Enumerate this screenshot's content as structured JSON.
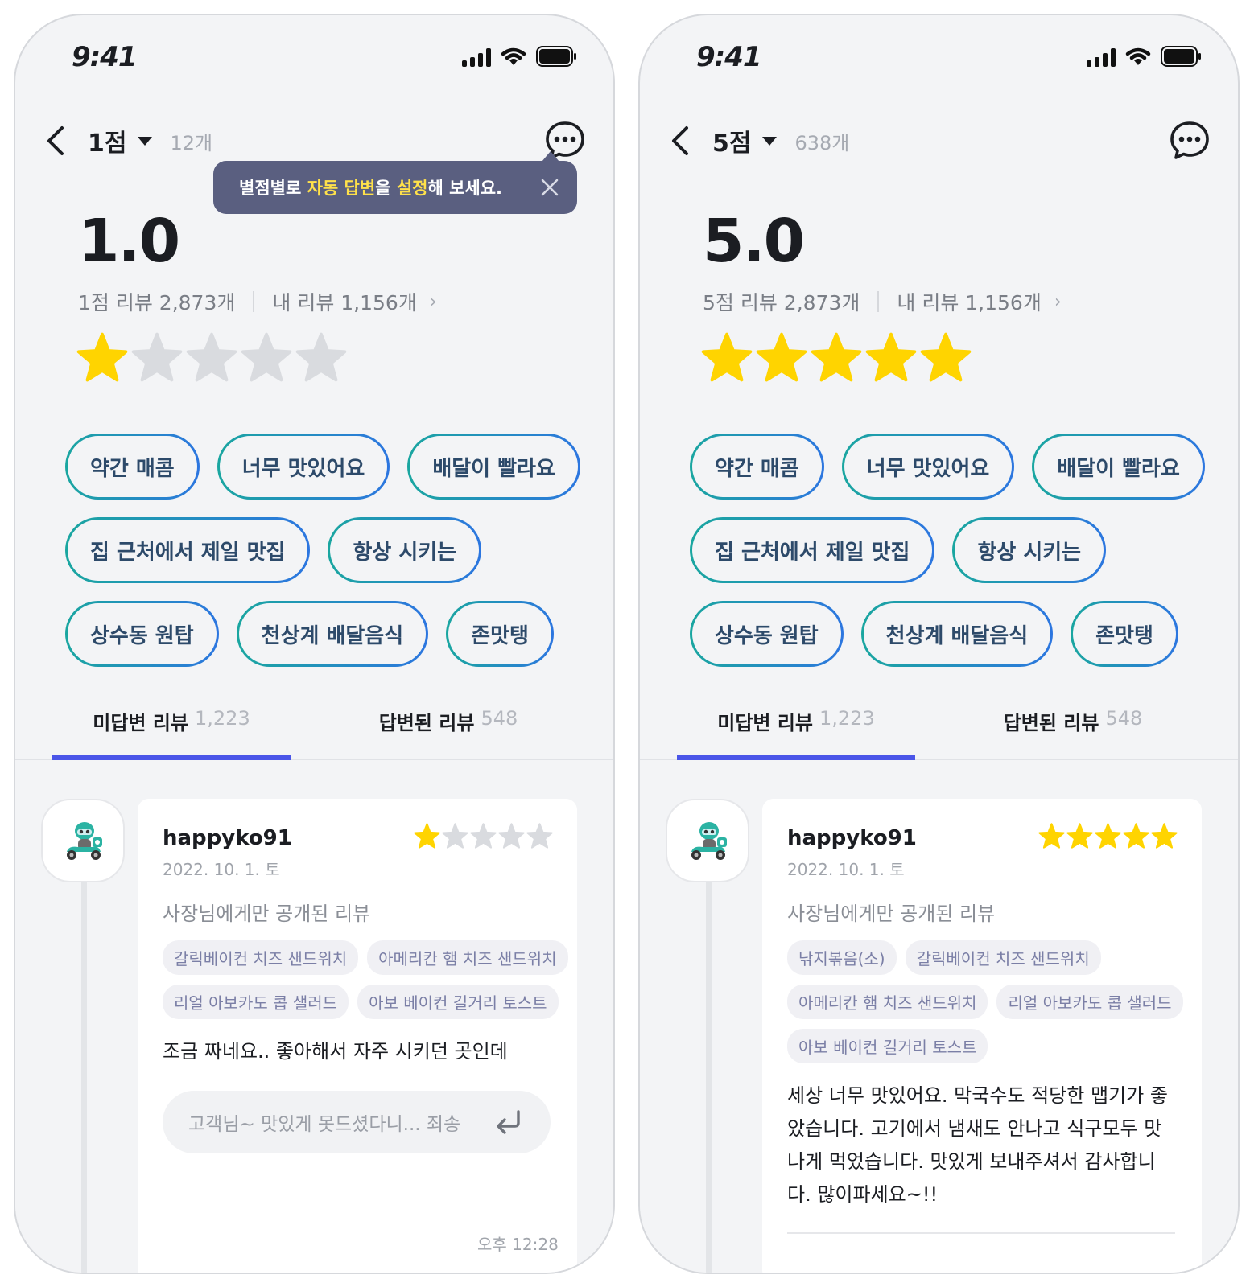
{
  "phones": [
    {
      "status": {
        "time": "9:41"
      },
      "header": {
        "score_label": "1점",
        "count_label": "12개"
      },
      "tooltip": {
        "pre": "별점별로 ",
        "hl1": "자동 답변",
        "mid": "을 ",
        "hl2": "설정",
        "post": "해 보세요."
      },
      "rating": {
        "value": "1.0",
        "label": "1점 리뷰 2,873개",
        "my_label": "내 리뷰 1,156개",
        "stars_filled": 1,
        "stars_total": 5
      },
      "keywords": [
        [
          "약간 매콤",
          "너무 맛있어요",
          "배달이 빨라요"
        ],
        [
          "집 근처에서 제일 맛집",
          "항상 시키는"
        ],
        [
          "상수동 원탑",
          "천상계 배달음식",
          "존맛탱"
        ]
      ],
      "tabs": [
        {
          "label": "미답변 리뷰",
          "count": "1,223"
        },
        {
          "label": "답변된 리뷰",
          "count": "548"
        }
      ],
      "review": {
        "username": "happyko91",
        "date": "2022. 10. 1. 토",
        "stars_filled": 1,
        "private_label": "사장님에게만 공개된 리뷰",
        "menu_tags": [
          "갈릭베이컨 치즈 샌드위치",
          "아메리칸 햄 치즈 샌드위치",
          "리얼 아보카도 콥 샐러드",
          "아보 베이컨 길거리 토스트"
        ],
        "text": "조금 짜네요.. 좋아해서 자주 시키던 곳인데",
        "reply_placeholder": "고객님~ 맛있게 못드셨다니... 죄송",
        "time": "오후 12:28"
      }
    },
    {
      "status": {
        "time": "9:41"
      },
      "header": {
        "score_label": "5점",
        "count_label": "638개"
      },
      "rating": {
        "value": "5.0",
        "label": "5점 리뷰 2,873개",
        "my_label": "내 리뷰 1,156개",
        "stars_filled": 5,
        "stars_total": 5
      },
      "keywords": [
        [
          "약간 매콤",
          "너무 맛있어요",
          "배달이 빨라요"
        ],
        [
          "집 근처에서 제일 맛집",
          "항상 시키는"
        ],
        [
          "상수동 원탑",
          "천상계 배달음식",
          "존맛탱"
        ]
      ],
      "tabs": [
        {
          "label": "미답변 리뷰",
          "count": "1,223"
        },
        {
          "label": "답변된 리뷰",
          "count": "548"
        }
      ],
      "review": {
        "username": "happyko91",
        "date": "2022. 10. 1. 토",
        "stars_filled": 5,
        "private_label": "사장님에게만 공개된 리뷰",
        "menu_tags": [
          "낚지볶음(소)",
          "갈릭베이컨 치즈 샌드위치",
          "아메리칸 햄 치즈 샌드위치",
          "리얼 아보카도 콥 샐러드",
          "아보 베이컨 길거리 토스트"
        ],
        "text": "세상 너무 맛있어요. 막국수도 적당한 맵기가 좋았습니다. 고기에서 냄새도 안나고 식구모두 맛나게 먹었습니다. 맛있게 보내주셔서 감사합니다. 많이파세요~!!"
      }
    }
  ],
  "colors": {
    "star_on": "#ffd400",
    "star_off": "#d9dbdf",
    "accent": "#4a55e8",
    "tooltip_bg": "#5a5f80",
    "chip_grad_start": "#1aa6a0",
    "chip_grad_end": "#2c76e0"
  },
  "icons": [
    "chevron-left-icon",
    "caret-down-icon",
    "chat-bubble-icon",
    "close-icon",
    "star-icon",
    "enter-icon",
    "signal-icon",
    "wifi-icon",
    "battery-icon",
    "delivery-rider-icon"
  ]
}
